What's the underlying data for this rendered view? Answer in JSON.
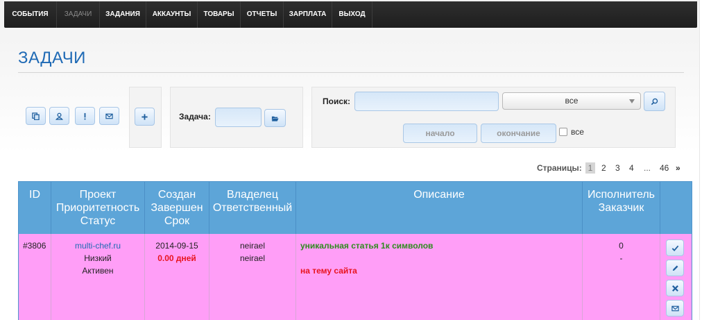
{
  "nav": {
    "items": [
      {
        "label": "СОБЫТИЯ"
      },
      {
        "label": "ЗАДАЧИ"
      },
      {
        "label": "ЗАДАНИЯ"
      },
      {
        "label": "АККАУНТЫ"
      },
      {
        "label": "ТОВАРЫ"
      },
      {
        "label": "ОТЧЕТЫ"
      },
      {
        "label": "ЗАРПЛАТА"
      },
      {
        "label": "ВЫХОД"
      }
    ]
  },
  "page": {
    "title": "ЗАДАЧИ"
  },
  "toolbar": {
    "filter_icons": [
      "copy-icon",
      "user-icon",
      "exclamation-icon",
      "envelope-icon"
    ],
    "add_label": "+"
  },
  "task_lookup": {
    "label": "Задача:",
    "value": ""
  },
  "search": {
    "label": "Поиск:",
    "value": "",
    "select_value": "все",
    "start_label": "начало",
    "end_label": "окончание",
    "all_checkbox_label": "все"
  },
  "pager": {
    "label": "Страницы:",
    "current": "1",
    "pages": [
      "2",
      "3",
      "4"
    ],
    "ellipsis": "...",
    "last": "46",
    "next": "»"
  },
  "table": {
    "headers": {
      "id": "ID",
      "project": [
        "Проект",
        "Приоритетность",
        "Статус"
      ],
      "created": [
        "Создан",
        "Завершен",
        "Срок"
      ],
      "owner": [
        "Владелец",
        "Ответственный"
      ],
      "description": "Описание",
      "executor": [
        "Исполнитель",
        "Заказчик"
      ]
    },
    "rows": [
      {
        "id": "#3806",
        "project": "multi-chef.ru",
        "priority": "Низкий",
        "status": "Активен",
        "created": "2014-09-15",
        "deadline": "0.00 дней",
        "owner": "neirael",
        "responsible": "neirael",
        "description_title": "уникальная статья 1к символов",
        "description_text": "на тему сайта",
        "executor": "0",
        "customer": "-"
      }
    ]
  },
  "colors": {
    "nav_bg": "#262626",
    "title": "#1f6ab5",
    "table_header": "#5da5d8",
    "row_bg": "#ff9ef7",
    "red_text": "#e8141e",
    "green_text": "#2e8b1f"
  }
}
